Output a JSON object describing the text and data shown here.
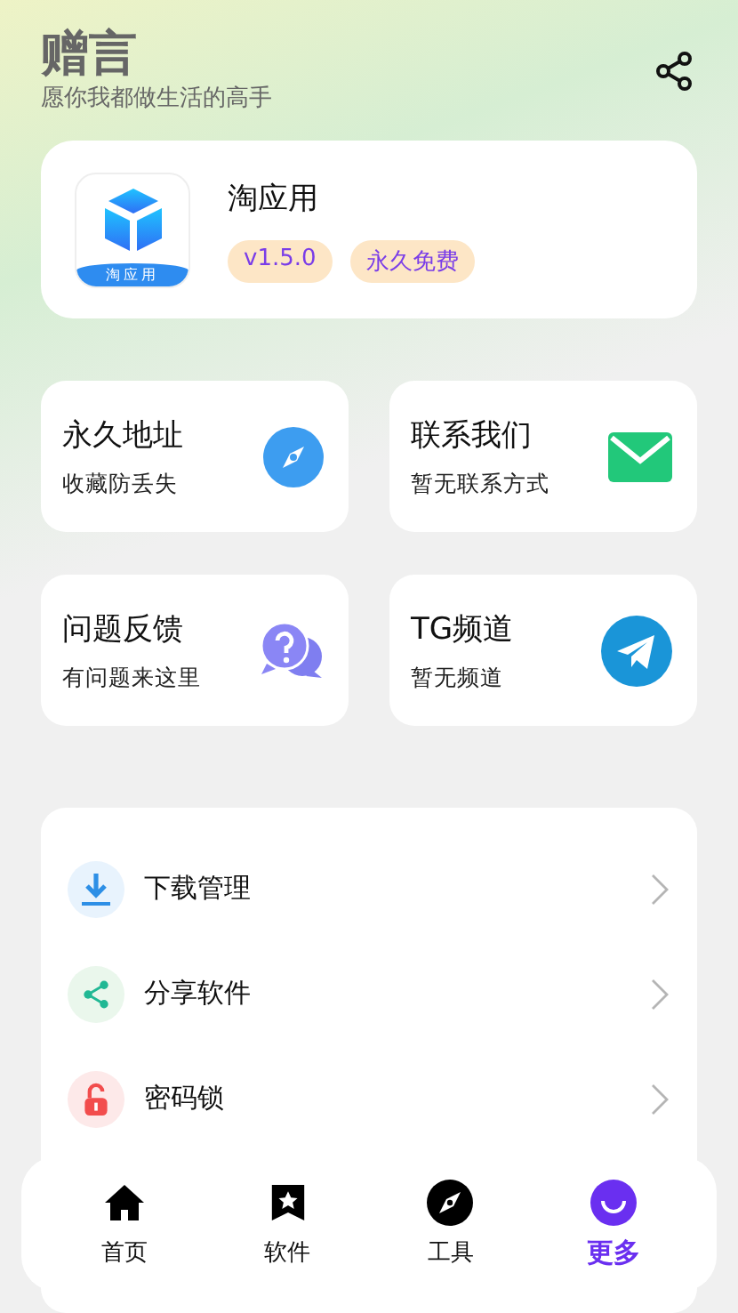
{
  "header": {
    "title": "赠言",
    "subtitle": "愿你我都做生活的高手"
  },
  "app": {
    "logo_label": "淘应用",
    "name": "淘应用",
    "tags": [
      "v1.5.0",
      "永久免费"
    ]
  },
  "cards": [
    {
      "title": "永久地址",
      "subtitle": "收藏防丢失"
    },
    {
      "title": "联系我们",
      "subtitle": "暂无联系方式"
    },
    {
      "title": "问题反馈",
      "subtitle": "有问题来这里"
    },
    {
      "title": "TG频道",
      "subtitle": "暂无频道"
    }
  ],
  "menu": [
    {
      "label": "下载管理"
    },
    {
      "label": "分享软件"
    },
    {
      "label": "密码锁"
    }
  ],
  "tab_bar": [
    {
      "label": "首页",
      "selected": false
    },
    {
      "label": "软件",
      "selected": false
    },
    {
      "label": "工具",
      "selected": false
    },
    {
      "label": "更多",
      "selected": true
    }
  ]
}
